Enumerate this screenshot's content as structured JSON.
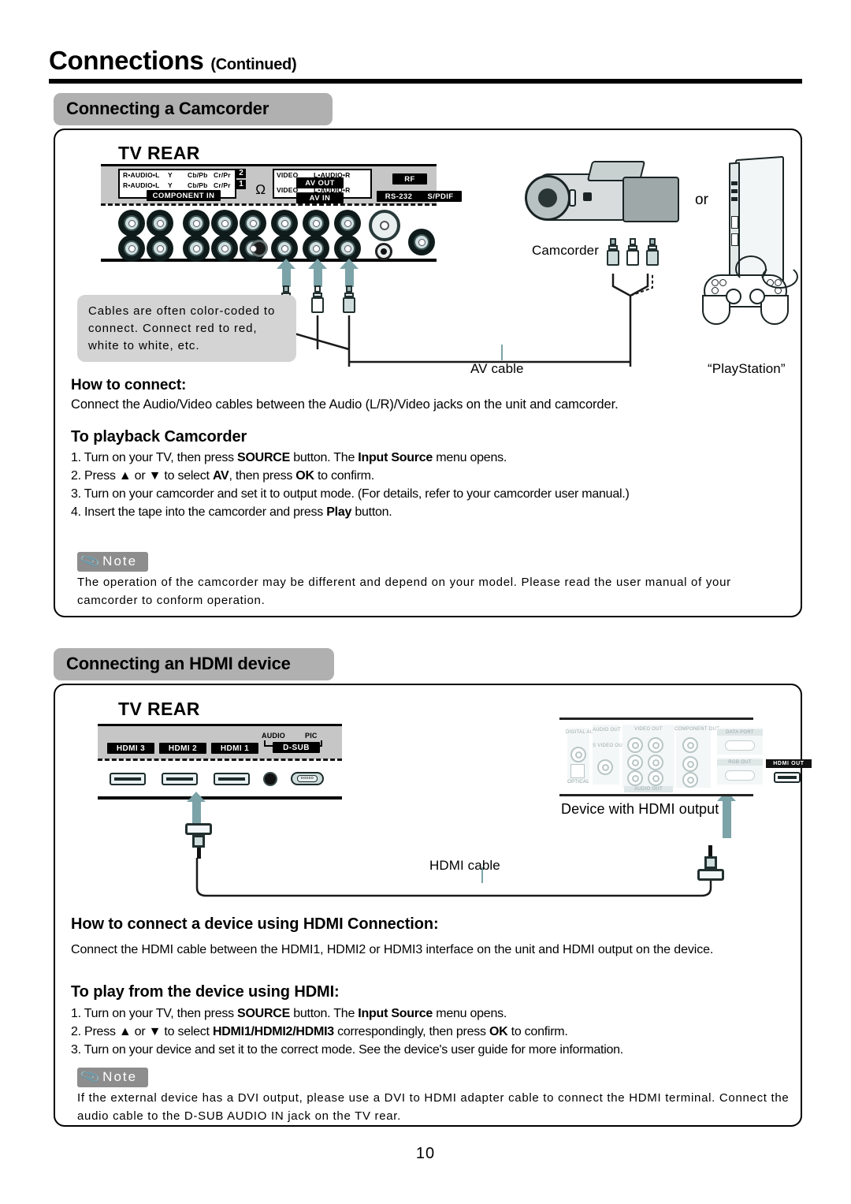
{
  "header": {
    "title": "Connections",
    "continued": "(Continued)"
  },
  "sections": [
    {
      "tab_label": "Connecting a Camcorder"
    },
    {
      "tab_label": "Connecting an HDMI device"
    }
  ],
  "camcorder_section": {
    "tv_rear_caption": "TV REAR",
    "jack_panel": {
      "component_labels": {
        "audio": "R•AUDIO•L",
        "y": "Y",
        "cb": "Cb/Pb",
        "cr": "Cr/Pr",
        "row2_num": "2",
        "row1_num": "1",
        "component_in": "COMPONENT IN"
      },
      "av_labels": {
        "video": "VIDEO",
        "audio": "L•AUDIO•R",
        "av_out": "AV OUT",
        "av_in": "AV IN"
      },
      "rf": "RF",
      "rs232": "RS-232",
      "spdif": "S/PDIF"
    },
    "callout": "Cables are often color-coded to connect. Connect red to red, white to white, etc.",
    "labels": {
      "camcorder": "Camcorder",
      "av_cable": "AV cable",
      "or": "or",
      "playstation": "“PlayStation”"
    },
    "how_to_connect_heading": "How to connect:",
    "how_to_connect_body": "Connect the Audio/Video cables between the Audio (L/R)/Video jacks on the unit and camcorder.",
    "playback_heading": "To playback Camcorder",
    "steps": [
      {
        "num": "1.",
        "parts": [
          {
            "t": "Turn on your TV,  then press ",
            "b": false
          },
          {
            "t": "SOURCE",
            "b": true
          },
          {
            "t": " button. The ",
            "b": false
          },
          {
            "t": "Input Source",
            "b": true
          },
          {
            "t": " menu opens.",
            "b": false
          }
        ]
      },
      {
        "num": "2.",
        "parts": [
          {
            "t": "Press ",
            "b": false
          },
          {
            "t": "▲",
            "b": false
          },
          {
            "t": " or ",
            "b": false
          },
          {
            "t": "▼",
            "b": false
          },
          {
            "t": " to select ",
            "b": false
          },
          {
            "t": "AV",
            "b": true
          },
          {
            "t": ", then press ",
            "b": false
          },
          {
            "t": "OK",
            "b": true
          },
          {
            "t": " to confirm.",
            "b": false
          }
        ]
      },
      {
        "num": "3.",
        "parts": [
          {
            "t": "Turn on your camcorder and set it to output mode. (For details, refer to your camcorder user manual.)",
            "b": false
          }
        ]
      },
      {
        "num": "4.",
        "parts": [
          {
            "t": "Insert the tape into the camcorder and press ",
            "b": false
          },
          {
            "t": "Play",
            "b": true
          },
          {
            "t": " button.",
            "b": false
          }
        ]
      }
    ],
    "note_badge": "Note",
    "note_text": "The operation of the camcorder may be different and depend on your model. Please read the user manual of your camcorder to conform operation."
  },
  "hdmi_section": {
    "tv_rear_caption": "TV REAR",
    "jack_panel": {
      "hdmi3": "HDMI 3",
      "hdmi2": "HDMI 2",
      "hdmi1": "HDMI 1",
      "audio": "AUDIO",
      "pic": "PIC",
      "dsub": "D-SUB"
    },
    "device_panel": {
      "audio_out": "AUDIO OUT",
      "video_out": "VIDEO OUT",
      "component_out": "COMPONENT OUT",
      "digital_audio_out": "DIGITAL AUDIO OUT",
      "optical": "OPTICAL",
      "s_video_out": "S VIDEO OUT",
      "audio_out_bottom": "AUDIO OUT",
      "data_port": "DATA PORT",
      "rgb_out": "RGB OUT",
      "hdmi_out": "HDMI OUT"
    },
    "labels": {
      "device_with_hdmi_output": "Device with HDMI output",
      "hdmi_cable": "HDMI cable"
    },
    "how_to_connect_heading": "How to connect a device using HDMI Connection:",
    "how_to_connect_body": "Connect the HDMI cable between the HDMI1, HDMI2 or HDMI3 interface on the unit and HDMI output on the device.",
    "play_heading": "To play from the device using HDMI:",
    "steps": [
      {
        "num": "1.",
        "parts": [
          {
            "t": "Turn on your TV,  then press ",
            "b": false
          },
          {
            "t": "SOURCE",
            "b": true
          },
          {
            "t": " button. The ",
            "b": false
          },
          {
            "t": "Input Source",
            "b": true
          },
          {
            "t": " menu opens.",
            "b": false
          }
        ]
      },
      {
        "num": "2.",
        "parts": [
          {
            "t": "Press ",
            "b": false
          },
          {
            "t": "▲",
            "b": false
          },
          {
            "t": " or ",
            "b": false
          },
          {
            "t": "▼",
            "b": false
          },
          {
            "t": " to select ",
            "b": false
          },
          {
            "t": "HDMI1/HDMI2/HDMI3",
            "b": true
          },
          {
            "t": " correspondingly, then press ",
            "b": false
          },
          {
            "t": "OK",
            "b": true
          },
          {
            "t": " to confirm.",
            "b": false
          }
        ]
      },
      {
        "num": "3.",
        "parts": [
          {
            "t": "Turn on your device and set it to the correct mode. See the device's user guide for more information.",
            "b": false
          }
        ]
      }
    ],
    "note_badge": "Note",
    "note_text": "If the external device has a DVI output, please use a DVI to HDMI adapter cable to connect the HDMI terminal. Connect the audio cable to the D-SUB AUDIO IN jack on the TV rear."
  },
  "page_number": "10",
  "colors": {
    "tab_grey": "#b0b0b0",
    "callout_grey": "#d4d4d4",
    "note_grey": "#8d8d8d",
    "accent_teal": "#7ba3a8"
  }
}
